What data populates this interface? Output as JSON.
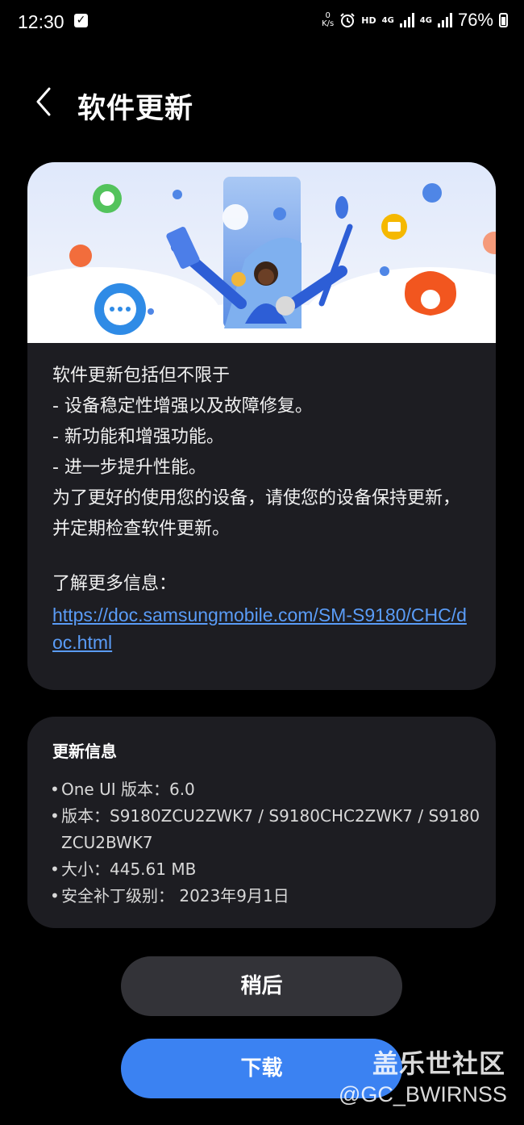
{
  "status_bar": {
    "time": "12:30",
    "net_speed_value": "0",
    "net_speed_unit": "K/s",
    "hd_label": "HD",
    "network1": "4G",
    "network2": "4G",
    "battery_percent": "76%"
  },
  "header": {
    "title": "软件更新"
  },
  "description": {
    "lines": [
      "软件更新包括但不限于",
      "- 设备稳定性增强以及故障修复。",
      "- 新功能和增强功能。",
      "- 进一步提升性能。",
      "为了更好的使用您的设备，请使您的设备保持更新，并定期检查软件更新。"
    ],
    "learn_more_label": "了解更多信息：",
    "link": "https://doc.samsungmobile.com/SM-S9180/CHC/doc.html"
  },
  "update_info": {
    "title": "更新信息",
    "items": [
      "One UI 版本：6.0",
      "版本：S9180ZCU2ZWK7 / S9180CHC2ZWK7 / S9180ZCU2BWK7",
      "大小：445.61 MB",
      "安全补丁级别： 2023年9月1日"
    ]
  },
  "buttons": {
    "later": "稍后",
    "download": "下载"
  },
  "watermark": {
    "line1": "盖乐世社区",
    "line2": "@GC_BWIRNSS"
  },
  "colors": {
    "background": "#000000",
    "card": "#1d1d22",
    "link": "#5a9cf7",
    "primary_button": "#3b82f2",
    "secondary_button": "#333338"
  }
}
